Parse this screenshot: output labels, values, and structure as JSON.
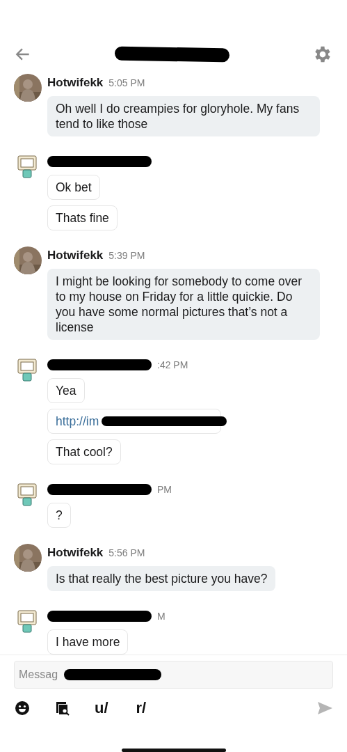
{
  "header": {
    "title_redacted": true
  },
  "messages": [
    {
      "name": "Hotwifekk",
      "redacted": false,
      "time": "5:05 PM",
      "from_me": false,
      "avatar": {
        "kind": "picture"
      },
      "bubbles": [
        {
          "kind": "text",
          "text": "Oh well I do creampies for gloryhole. My fans tend to like those"
        }
      ]
    },
    {
      "redacted": true,
      "from_me": true,
      "avatar": {
        "kind": "robot"
      },
      "bubbles": [
        {
          "kind": "text",
          "text": "Ok bet"
        },
        {
          "kind": "text",
          "text": "Thats fine"
        }
      ]
    },
    {
      "name": "Hotwifekk",
      "redacted": false,
      "time": "5:39 PM",
      "from_me": false,
      "avatar": {
        "kind": "picture"
      },
      "bubbles": [
        {
          "kind": "text",
          "text": "I might be looking for somebody to come over to my house on Friday for a little quickie. Do you have some normal pictures that’s not a license"
        }
      ]
    },
    {
      "redacted": true,
      "time": ":42 PM",
      "from_me": true,
      "avatar": {
        "kind": "robot"
      },
      "bubbles": [
        {
          "kind": "text",
          "text": "Yea"
        },
        {
          "kind": "link",
          "text": "http://im",
          "redacted": true
        },
        {
          "kind": "text",
          "text": "That cool?"
        }
      ]
    },
    {
      "redacted": true,
      "time": "PM",
      "from_me": true,
      "avatar": {
        "kind": "robot"
      },
      "bubbles": [
        {
          "kind": "text",
          "text": "?"
        }
      ]
    },
    {
      "name": "Hotwifekk",
      "redacted": false,
      "time": "5:56 PM",
      "from_me": false,
      "avatar": {
        "kind": "picture"
      },
      "bubbles": [
        {
          "kind": "text",
          "text": "Is that really the best picture you have?"
        }
      ]
    },
    {
      "redacted": true,
      "time": "M",
      "from_me": true,
      "avatar": {
        "kind": "robot"
      },
      "bubbles": [
        {
          "kind": "text",
          "text": "I have more"
        }
      ]
    }
  ],
  "composer": {
    "placeholder": "Messag",
    "redacted": true
  },
  "toolbar": [
    {
      "kind": "emoji"
    },
    {
      "kind": "media"
    },
    {
      "kind": "text",
      "label": "u/"
    },
    {
      "kind": "text",
      "label": "r/"
    }
  ],
  "send": {
    "disabled": true
  }
}
